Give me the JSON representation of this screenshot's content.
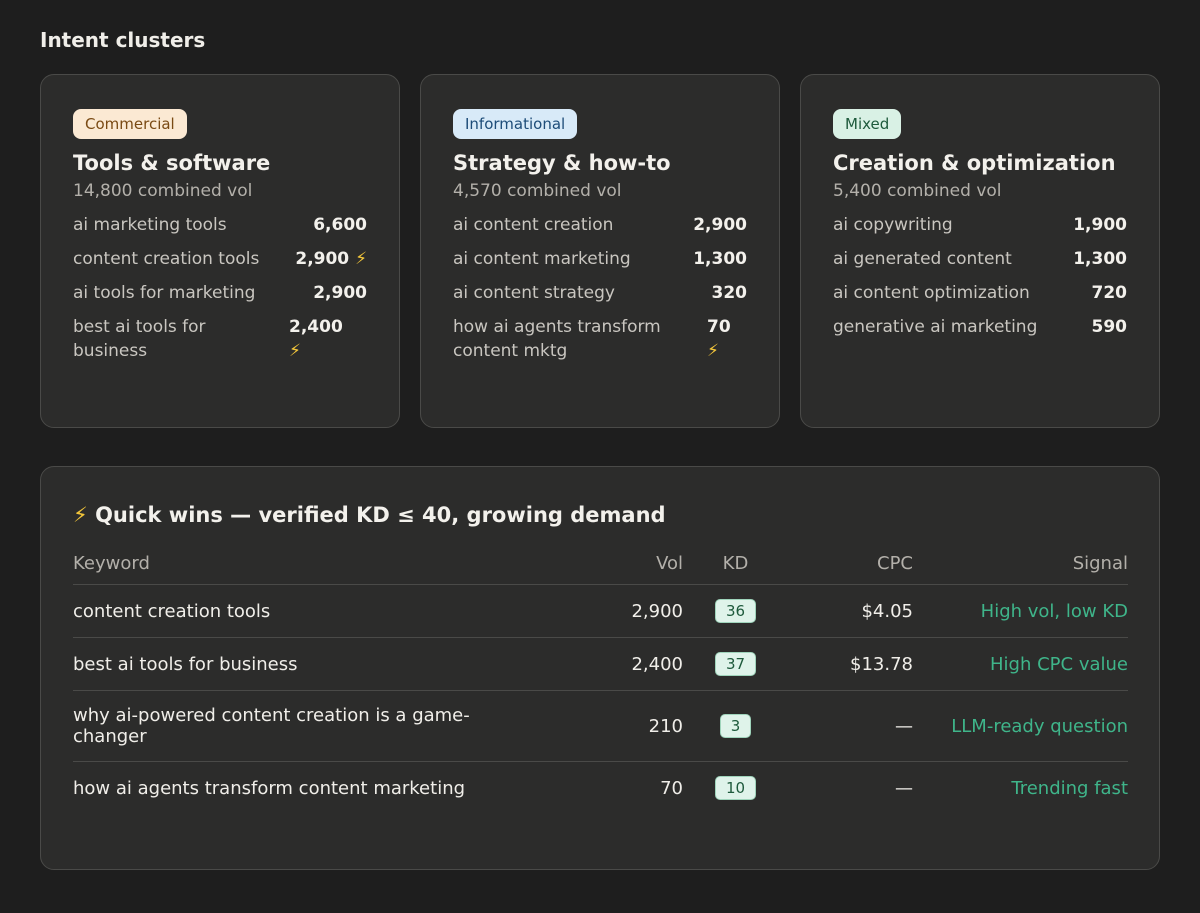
{
  "section_title": "Intent clusters",
  "clusters": [
    {
      "badge": "Commercial",
      "title": "Tools & software",
      "subtitle": "14,800 combined vol",
      "keywords": [
        {
          "name": "ai marketing tools",
          "value": "6,600",
          "bolt": ""
        },
        {
          "name": "content creation tools",
          "value": "2,900",
          "bolt": "⚡"
        },
        {
          "name": "ai tools for marketing",
          "value": "2,900",
          "bolt": ""
        },
        {
          "name": "best ai tools for business",
          "value": "2,400",
          "bolt": "⚡"
        }
      ]
    },
    {
      "badge": "Informational",
      "title": "Strategy & how-to",
      "subtitle": "4,570 combined vol",
      "keywords": [
        {
          "name": "ai content creation",
          "value": "2,900",
          "bolt": ""
        },
        {
          "name": "ai content marketing",
          "value": "1,300",
          "bolt": ""
        },
        {
          "name": "ai content strategy",
          "value": "320",
          "bolt": ""
        },
        {
          "name": "how ai agents transform content mktg",
          "value": "70",
          "bolt": "⚡"
        }
      ]
    },
    {
      "badge": "Mixed",
      "title": "Creation & optimization",
      "subtitle": "5,400 combined vol",
      "keywords": [
        {
          "name": "ai copywriting",
          "value": "1,900",
          "bolt": ""
        },
        {
          "name": "ai generated content",
          "value": "1,300",
          "bolt": ""
        },
        {
          "name": "ai content optimization",
          "value": "720",
          "bolt": ""
        },
        {
          "name": "generative ai marketing",
          "value": "590",
          "bolt": ""
        }
      ]
    }
  ],
  "quick_wins": {
    "icon": "⚡",
    "title": "Quick wins — verified KD ≤ 40, growing demand",
    "headers": {
      "keyword": "Keyword",
      "vol": "Vol",
      "kd": "KD",
      "cpc": "CPC",
      "signal": "Signal"
    },
    "rows": [
      {
        "keyword": "content creation tools",
        "vol": "2,900",
        "kd": "36",
        "cpc": "$4.05",
        "signal": "High vol, low KD"
      },
      {
        "keyword": "best ai tools for business",
        "vol": "2,400",
        "kd": "37",
        "cpc": "$13.78",
        "signal": "High CPC value"
      },
      {
        "keyword": "why ai-powered content creation is a game-changer",
        "vol": "210",
        "kd": "3",
        "cpc": "—",
        "signal": "LLM-ready question"
      },
      {
        "keyword": "how ai agents transform content marketing",
        "vol": "70",
        "kd": "10",
        "cpc": "—",
        "signal": "Trending fast"
      }
    ]
  },
  "colors": {
    "background": "#1e1e1e",
    "card": "#2c2c2b",
    "signal_green": "#3fb58a",
    "bolt_yellow": "#f2c53a"
  }
}
